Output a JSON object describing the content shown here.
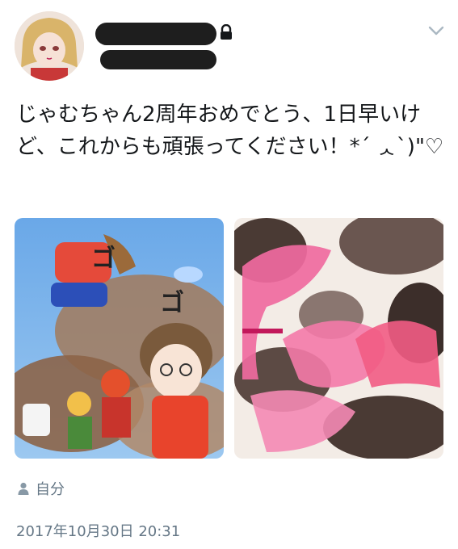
{
  "tweet": {
    "text": "じゃむちゃん2周年おめでとう、1日早いけど、これからも頑張ってください！*´ ᆺ`)\"♡",
    "location": "自分",
    "timestamp": "2017年10月30日 20:31"
  },
  "icons": {
    "lock": "lock-icon",
    "caret": "chevron-down-icon",
    "person": "person-icon"
  },
  "colors": {
    "text": "#14171a",
    "meta": "#657786",
    "redaction": "#1e1e1e"
  }
}
